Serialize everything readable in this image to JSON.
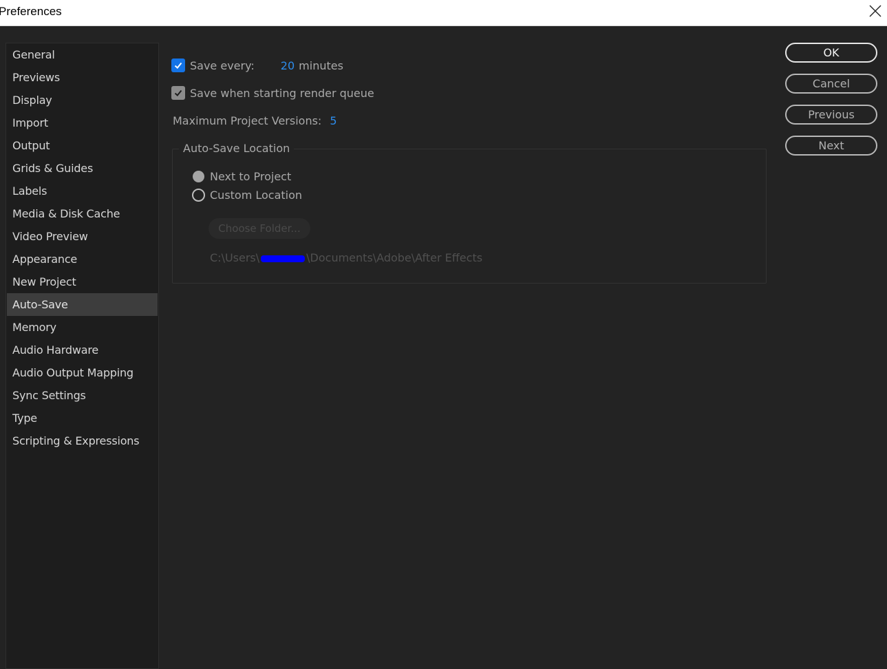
{
  "window": {
    "title": "Preferences"
  },
  "sidebar": {
    "items": [
      {
        "label": "General"
      },
      {
        "label": "Previews"
      },
      {
        "label": "Display"
      },
      {
        "label": "Import"
      },
      {
        "label": "Output"
      },
      {
        "label": "Grids & Guides"
      },
      {
        "label": "Labels"
      },
      {
        "label": "Media & Disk Cache"
      },
      {
        "label": "Video Preview"
      },
      {
        "label": "Appearance"
      },
      {
        "label": "New Project"
      },
      {
        "label": "Auto-Save"
      },
      {
        "label": "Memory"
      },
      {
        "label": "Audio Hardware"
      },
      {
        "label": "Audio Output Mapping"
      },
      {
        "label": "Sync Settings"
      },
      {
        "label": "Type"
      },
      {
        "label": "Scripting & Expressions"
      }
    ],
    "selected": "Auto-Save"
  },
  "autosave": {
    "save_every_label": "Save every:",
    "save_every_checked": true,
    "save_every_value": "20",
    "save_every_unit": "minutes",
    "render_queue_label": "Save when starting render queue",
    "render_queue_checked": true,
    "max_versions_label": "Maximum Project Versions:",
    "max_versions_value": "5",
    "location_group_label": "Auto-Save Location",
    "option_next_to_project": "Next to Project",
    "option_custom_location": "Custom Location",
    "selected_option": "Next to Project",
    "choose_folder_label": "Choose Folder...",
    "path_prefix": "C:\\Users\\",
    "path_suffix": "\\Documents\\Adobe\\After Effects"
  },
  "buttons": {
    "ok": "OK",
    "cancel": "Cancel",
    "previous": "Previous",
    "next": "Next"
  },
  "colors": {
    "accent": "#1473e6",
    "value_blue": "#2d8ceb",
    "background": "#232323",
    "sidebar_bg": "#1d1d1d",
    "selected_bg": "#3d3d3d",
    "redaction": "#0000ff"
  }
}
